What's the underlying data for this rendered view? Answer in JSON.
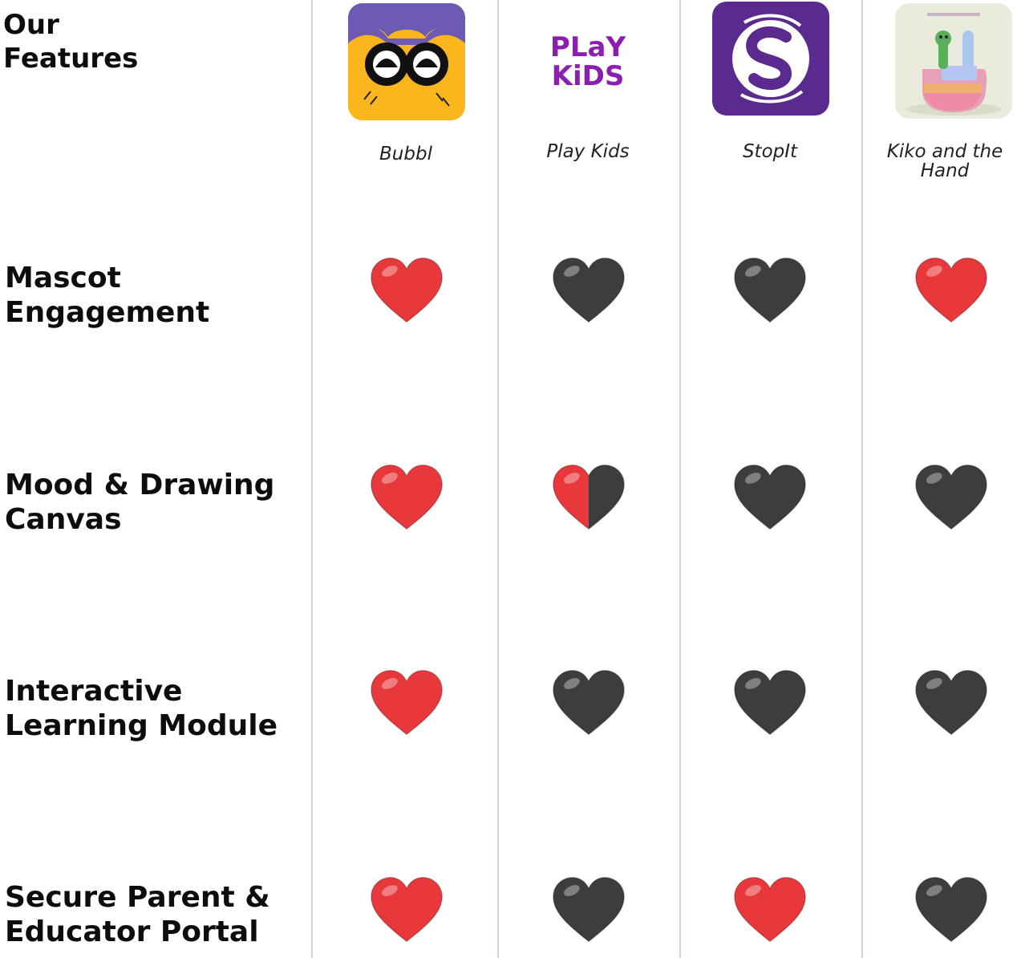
{
  "heading": {
    "line1": "Our",
    "line2": "Features"
  },
  "apps": [
    {
      "name": "Bubbl",
      "icon": "bubbl-mascot-icon"
    },
    {
      "name": "Play Kids",
      "icon": "playkids-logo-icon",
      "logo_lines": [
        "PLaY",
        "KiDS"
      ]
    },
    {
      "name": "StopIt",
      "icon": "stopit-logo-icon"
    },
    {
      "name": "Kiko and the Hand",
      "icon": "kiko-hand-icon"
    }
  ],
  "features": [
    {
      "line1": "Mascot",
      "line2": "Engagement",
      "ratings": [
        "full",
        "none",
        "none",
        "full"
      ]
    },
    {
      "line1": "Mood & Drawing",
      "line2": "Canvas",
      "ratings": [
        "full",
        "half",
        "none",
        "none"
      ]
    },
    {
      "line1": "Interactive",
      "line2": "Learning Module",
      "ratings": [
        "full",
        "none",
        "none",
        "none"
      ]
    },
    {
      "line1": "Secure Parent &",
      "line2": "Educator Portal",
      "ratings": [
        "full",
        "none",
        "full",
        "none"
      ]
    }
  ],
  "colors": {
    "heart_full": "#e8383b",
    "heart_none": "#3d3d3d",
    "divider": "#c9d6ea",
    "playkids": "#8a1fb0",
    "stopit": "#5b2a8e",
    "bubbl_yellow": "#fcb61d",
    "bubbl_purple": "#6d5bb3"
  }
}
